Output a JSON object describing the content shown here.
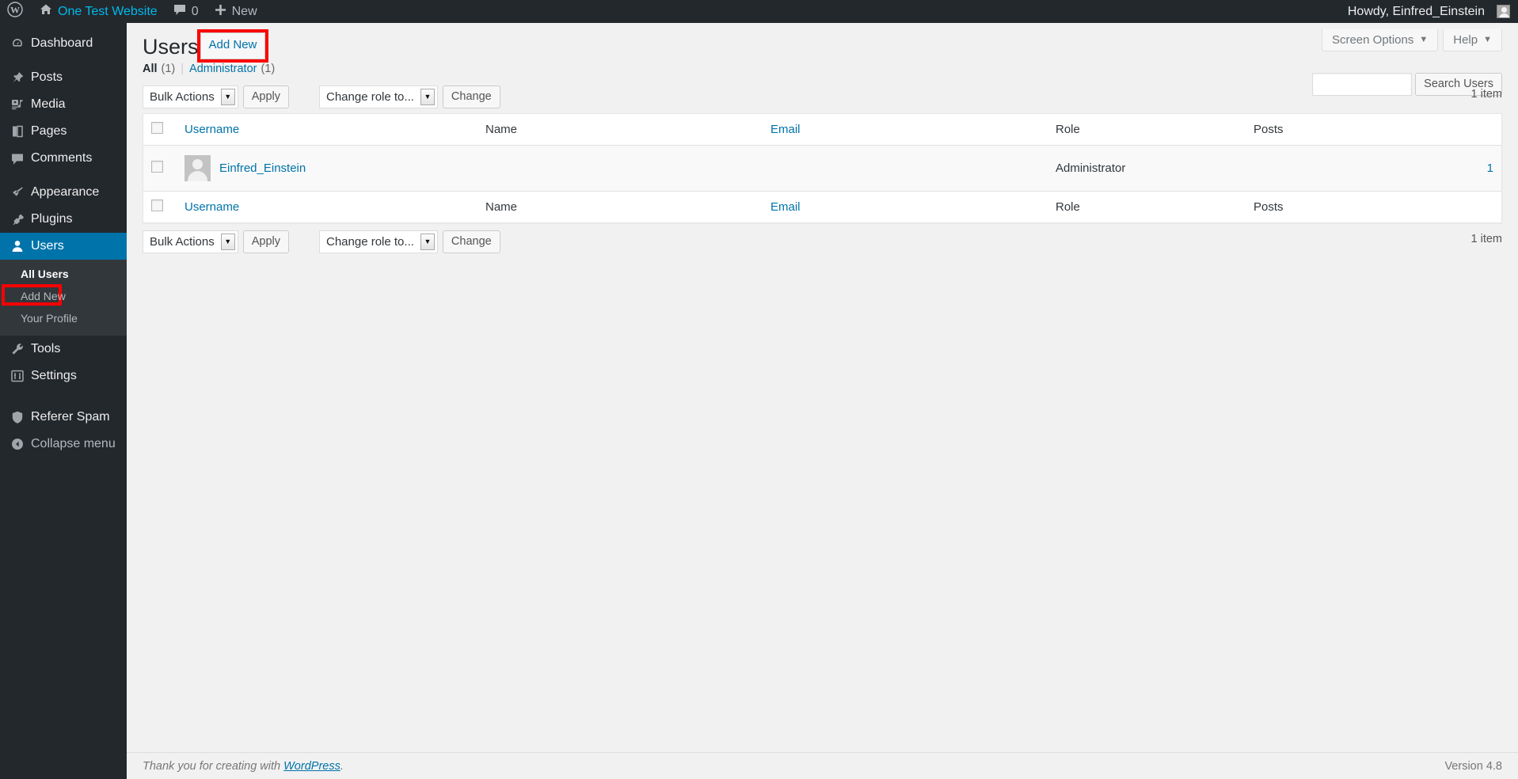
{
  "adminbar": {
    "logo_icon": "wordpress-logo-icon",
    "home_icon": "home-icon",
    "site_name": "One Test Website",
    "comments_icon": "comment-bubble-icon",
    "comments_count": "0",
    "new_icon": "plus-icon",
    "new_label": "New",
    "howdy": "Howdy, Einfred_Einstein",
    "avatar_icon": "user-avatar-icon"
  },
  "sidebar": {
    "items": [
      {
        "label": "Dashboard",
        "icon": "dashboard-gauge-icon",
        "name": "dashboard"
      },
      {
        "label": "Posts",
        "icon": "pushpin-icon",
        "name": "posts"
      },
      {
        "label": "Media",
        "icon": "media-music-note-icon",
        "name": "media"
      },
      {
        "label": "Pages",
        "icon": "pages-document-icon",
        "name": "pages"
      },
      {
        "label": "Comments",
        "icon": "comment-bubble-icon",
        "name": "comments"
      },
      {
        "label": "Appearance",
        "icon": "paintbrush-icon",
        "name": "appearance"
      },
      {
        "label": "Plugins",
        "icon": "plug-icon",
        "name": "plugins"
      },
      {
        "label": "Users",
        "icon": "user-icon",
        "name": "users"
      },
      {
        "label": "Tools",
        "icon": "wrench-icon",
        "name": "tools"
      },
      {
        "label": "Settings",
        "icon": "sliders-icon",
        "name": "settings"
      },
      {
        "label": "Referer Spam",
        "icon": "shield-icon",
        "name": "referer-spam"
      },
      {
        "label": "Collapse menu",
        "icon": "collapse-arrow-icon",
        "name": "collapse-menu"
      }
    ],
    "submenu": [
      {
        "label": "All Users",
        "current": true
      },
      {
        "label": "Add New",
        "current": false,
        "highlighted": true
      },
      {
        "label": "Your Profile",
        "current": false
      }
    ]
  },
  "screen_meta": {
    "screen_options_label": "Screen Options",
    "help_label": "Help",
    "caret": "▼"
  },
  "page": {
    "title": "Users",
    "add_new_label": "Add New",
    "highlight_color": "#ff0000"
  },
  "filters": {
    "all_label": "All",
    "all_count": "(1)",
    "separator": "|",
    "administrator_label": "Administrator",
    "administrator_count": "(1)"
  },
  "search": {
    "value": "",
    "placeholder": "",
    "button_label": "Search Users"
  },
  "tablenav": {
    "bulk_actions_label": "Bulk Actions",
    "apply_label": "Apply",
    "change_role_label": "Change role to...",
    "change_label": "Change",
    "item_count": "1 item",
    "arrow": "▼"
  },
  "table": {
    "columns": {
      "username": "Username",
      "name": "Name",
      "email": "Email",
      "role": "Role",
      "posts": "Posts"
    },
    "rows": [
      {
        "username": "Einfred_Einstein",
        "name": "",
        "email": "",
        "role": "Administrator",
        "posts": "1",
        "avatar_icon": "user-avatar-icon"
      }
    ]
  },
  "footer": {
    "thanks_prefix": "Thank you for creating with ",
    "wordpress_link": "WordPress",
    "thanks_suffix": ".",
    "version": "Version 4.8"
  }
}
